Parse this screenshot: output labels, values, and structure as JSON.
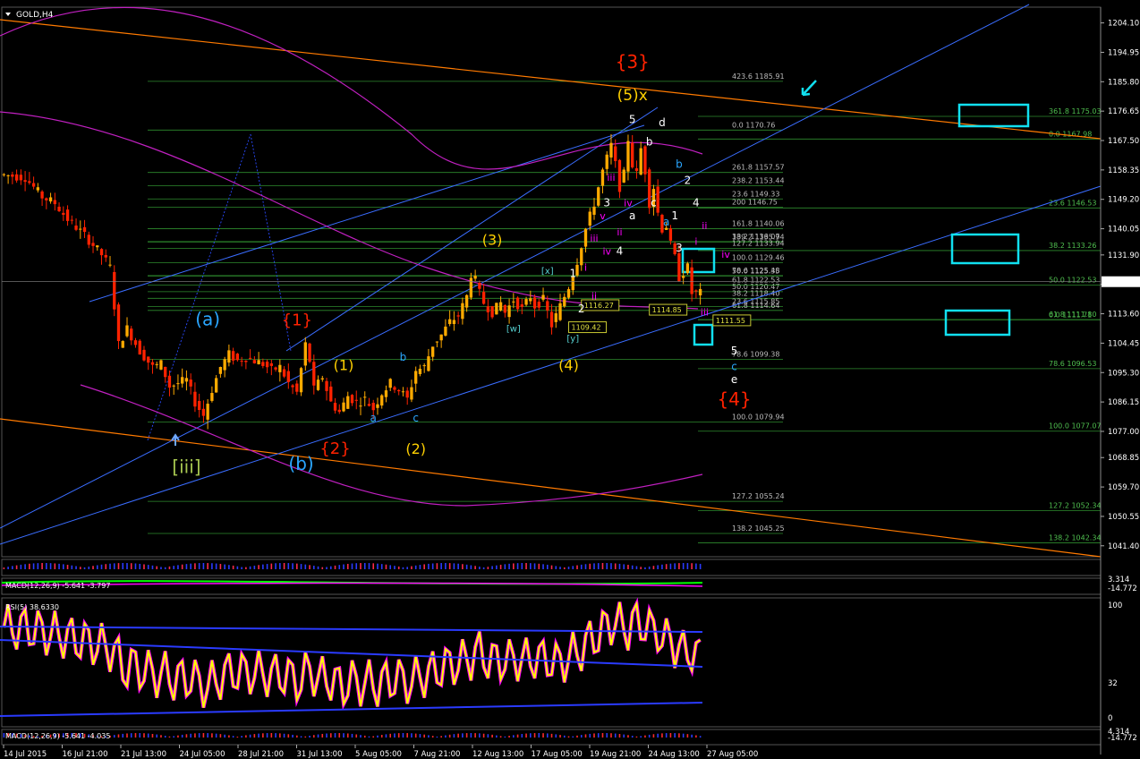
{
  "symbol": "GOLD,H4",
  "chart_data": {
    "type": "candlestick",
    "title": "GOLD,H4",
    "ylim": [
      1038.0,
      1209.0
    ],
    "ticks": [
      "1204.10",
      "1194.95",
      "1185.80",
      "1176.65",
      "1167.50",
      "1158.35",
      "1149.20",
      "1140.05",
      "1131.90",
      "1122.75",
      "1113.60",
      "1104.45",
      "1095.30",
      "1086.15",
      "1077.00",
      "1068.85",
      "1059.70",
      "1050.55",
      "1041.40"
    ],
    "current_price": "1123.58",
    "time_labels": [
      "14 Jul 2015",
      "16 Jul 21:00",
      "21 Jul 13:00",
      "24 Jul 05:00",
      "28 Jul 21:00",
      "31 Jul 13:00",
      "5 Aug 05:00",
      "7 Aug 21:00",
      "12 Aug 13:00",
      "17 Aug 05:00",
      "19 Aug 21:00",
      "24 Aug 13:00",
      "27 Aug 05:00"
    ],
    "price_path": [
      [
        0,
        1157
      ],
      [
        6,
        1156
      ],
      [
        10,
        1150
      ],
      [
        13,
        1148
      ],
      [
        16,
        1143
      ],
      [
        20,
        1138
      ],
      [
        24,
        1132
      ],
      [
        26,
        1128
      ],
      [
        28,
        1104
      ],
      [
        30,
        1109
      ],
      [
        33,
        1102
      ],
      [
        36,
        1097
      ],
      [
        38,
        1098
      ],
      [
        40,
        1091
      ],
      [
        44,
        1093
      ],
      [
        46,
        1086
      ],
      [
        48,
        1082
      ],
      [
        50,
        1090
      ],
      [
        52,
        1097
      ],
      [
        54,
        1101
      ],
      [
        56,
        1099
      ],
      [
        58,
        1100
      ],
      [
        62,
        1098
      ],
      [
        64,
        1096
      ],
      [
        66,
        1097
      ],
      [
        68,
        1092
      ],
      [
        70,
        1089
      ],
      [
        72,
        1104
      ],
      [
        73,
        1099
      ],
      [
        74,
        1090
      ],
      [
        76,
        1094
      ],
      [
        78,
        1086
      ],
      [
        80,
        1083
      ],
      [
        82,
        1088
      ],
      [
        84,
        1086
      ],
      [
        86,
        1087
      ],
      [
        88,
        1084
      ],
      [
        90,
        1089
      ],
      [
        92,
        1092
      ],
      [
        94,
        1090
      ],
      [
        96,
        1087
      ],
      [
        98,
        1096
      ],
      [
        100,
        1097
      ],
      [
        102,
        1104
      ],
      [
        104,
        1107
      ],
      [
        106,
        1111
      ],
      [
        108,
        1113
      ],
      [
        110,
        1119
      ],
      [
        111,
        1126
      ],
      [
        112,
        1124
      ],
      [
        113,
        1120
      ],
      [
        114,
        1117
      ],
      [
        116,
        1114
      ],
      [
        118,
        1117
      ],
      [
        119,
        1114
      ],
      [
        121,
        1118
      ],
      [
        123,
        1115
      ],
      [
        125,
        1119
      ],
      [
        126,
        1116
      ],
      [
        128,
        1118
      ],
      [
        130,
        1110
      ],
      [
        132,
        1116
      ],
      [
        134,
        1122
      ],
      [
        136,
        1130
      ],
      [
        138,
        1140
      ],
      [
        140,
        1148
      ],
      [
        142,
        1158
      ],
      [
        144,
        1166
      ],
      [
        145,
        1160
      ],
      [
        146,
        1153
      ],
      [
        147,
        1157
      ],
      [
        148,
        1168
      ],
      [
        149,
        1160
      ],
      [
        150,
        1157
      ],
      [
        151,
        1165
      ],
      [
        152,
        1158
      ],
      [
        153,
        1148
      ],
      [
        154,
        1153
      ],
      [
        155,
        1145
      ],
      [
        156,
        1140
      ],
      [
        157,
        1141
      ],
      [
        158,
        1135
      ],
      [
        159,
        1131
      ],
      [
        160,
        1125
      ],
      [
        162,
        1128
      ],
      [
        163,
        1120
      ],
      [
        164,
        1120
      ]
    ],
    "candles_count": 165,
    "elliott_labels": [
      {
        "t": "{3}",
        "x": 148,
        "y": 1190,
        "color": "#ff2200",
        "size": 20
      },
      {
        "t": "(5)x",
        "x": 148,
        "y": 1180,
        "color": "#ffd000",
        "size": 17
      },
      {
        "t": "5",
        "x": 148,
        "y": 1173,
        "color": "#ffffff",
        "size": 12
      },
      {
        "t": "d",
        "x": 155,
        "y": 1172,
        "color": "#ffffff",
        "size": 12
      },
      {
        "t": "b",
        "x": 152,
        "y": 1166,
        "color": "#ffffff",
        "size": 12
      },
      {
        "t": "b",
        "x": 159,
        "y": 1159,
        "color": "#2aa6ff",
        "size": 12
      },
      {
        "t": "2",
        "x": 161,
        "y": 1154,
        "color": "#ffffff",
        "size": 12
      },
      {
        "t": "iii",
        "x": 143,
        "y": 1155,
        "color": "#ff00ff",
        "size": 11
      },
      {
        "t": "3",
        "x": 142,
        "y": 1147,
        "color": "#ffffff",
        "size": 12
      },
      {
        "t": "v",
        "x": 141,
        "y": 1143,
        "color": "#ff00ff",
        "size": 11
      },
      {
        "t": "iv",
        "x": 147,
        "y": 1147,
        "color": "#ff00ff",
        "size": 11
      },
      {
        "t": "a",
        "x": 148,
        "y": 1143,
        "color": "#ffffff",
        "size": 12
      },
      {
        "t": "c",
        "x": 153,
        "y": 1147,
        "color": "#ffffff",
        "size": 12
      },
      {
        "t": "1",
        "x": 158,
        "y": 1143,
        "color": "#ffffff",
        "size": 12
      },
      {
        "t": "a",
        "x": 156,
        "y": 1141,
        "color": "#2aa6ff",
        "size": 12
      },
      {
        "t": "4",
        "x": 163,
        "y": 1147,
        "color": "#ffffff",
        "size": 12
      },
      {
        "t": "ii",
        "x": 165,
        "y": 1140,
        "color": "#ff00ff",
        "size": 11
      },
      {
        "t": "i",
        "x": 163,
        "y": 1135,
        "color": "#ff00ff",
        "size": 11
      },
      {
        "t": "3",
        "x": 159,
        "y": 1133,
        "color": "#ffffff",
        "size": 12
      },
      {
        "t": "iii",
        "x": 139,
        "y": 1136,
        "color": "#ff00ff",
        "size": 11
      },
      {
        "t": "ii",
        "x": 145,
        "y": 1138,
        "color": "#ff00ff",
        "size": 11
      },
      {
        "t": "iv",
        "x": 142,
        "y": 1132,
        "color": "#ff00ff",
        "size": 11
      },
      {
        "t": "4",
        "x": 145,
        "y": 1132,
        "color": "#ffffff",
        "size": 12
      },
      {
        "t": "i",
        "x": 137,
        "y": 1127,
        "color": "#ff00ff",
        "size": 11
      },
      {
        "t": "1",
        "x": 134,
        "y": 1125,
        "color": "#ffffff",
        "size": 12
      },
      {
        "t": "ii",
        "x": 139,
        "y": 1118,
        "color": "#ff00ff",
        "size": 11
      },
      {
        "t": "2",
        "x": 136,
        "y": 1114,
        "color": "#ffffff",
        "size": 12
      },
      {
        "t": "(3)",
        "x": 115,
        "y": 1135,
        "color": "#ffd000",
        "size": 16
      },
      {
        "t": "[x]",
        "x": 128,
        "y": 1126,
        "color": "#56d0d0",
        "size": 10
      },
      {
        "t": "[w]",
        "x": 120,
        "y": 1108,
        "color": "#56d0d0",
        "size": 10
      },
      {
        "t": "[y]",
        "x": 134,
        "y": 1105,
        "color": "#56d0d0",
        "size": 10
      },
      {
        "t": "(4)",
        "x": 133,
        "y": 1096,
        "color": "#ffd000",
        "size": 16
      },
      {
        "t": "iii",
        "x": 165,
        "y": 1113,
        "color": "#ff00ff",
        "size": 11
      },
      {
        "t": "iv",
        "x": 170,
        "y": 1131,
        "color": "#ff00ff",
        "size": 11
      },
      {
        "t": "5",
        "x": 172,
        "y": 1101,
        "color": "#ffffff",
        "size": 12
      },
      {
        "t": "c",
        "x": 172,
        "y": 1096,
        "color": "#2aa6ff",
        "size": 12
      },
      {
        "t": "e",
        "x": 172,
        "y": 1092,
        "color": "#ffffff",
        "size": 12
      },
      {
        "t": "{4}",
        "x": 172,
        "y": 1085,
        "color": "#ff2200",
        "size": 20
      },
      {
        "t": "(a)",
        "x": 48,
        "y": 1110,
        "color": "#2aa6ff",
        "size": 20
      },
      {
        "t": "{1}",
        "x": 69,
        "y": 1110,
        "color": "#ff2200",
        "size": 18
      },
      {
        "t": "(1)",
        "x": 80,
        "y": 1096,
        "color": "#ffd000",
        "size": 16
      },
      {
        "t": "b",
        "x": 94,
        "y": 1099,
        "color": "#2aa6ff",
        "size": 12
      },
      {
        "t": "a",
        "x": 87,
        "y": 1080,
        "color": "#2aa6ff",
        "size": 12
      },
      {
        "t": "c",
        "x": 97,
        "y": 1080,
        "color": "#2aa6ff",
        "size": 12
      },
      {
        "t": "(2)",
        "x": 97,
        "y": 1070,
        "color": "#ffd000",
        "size": 16
      },
      {
        "t": "{2}",
        "x": 78,
        "y": 1070,
        "color": "#ff2200",
        "size": 18
      },
      {
        "t": "(b)",
        "x": 70,
        "y": 1065,
        "color": "#2aa6ff",
        "size": 20
      },
      {
        "t": "[iii]",
        "x": 43,
        "y": 1064,
        "color": "#a8c850",
        "size": 20
      }
    ],
    "fib_left": [
      {
        "label": "423.6  1185.91",
        "price": 1185.91
      },
      {
        "label": "0.0  1170.76",
        "price": 1170.76
      },
      {
        "label": "261.8  1157.57",
        "price": 1157.57
      },
      {
        "label": "238.2  1153.44",
        "price": 1153.44
      },
      {
        "label": "23.6  1149.33",
        "price": 1149.33
      },
      {
        "label": "200  1146.75",
        "price": 1146.75
      },
      {
        "label": "161.8  1140.06",
        "price": 1140.06
      },
      {
        "label": "38.2  1136.07",
        "price": 1136.07
      },
      {
        "label": "139.2  1135.94",
        "price": 1135.94
      },
      {
        "label": "127.2  1133.94",
        "price": 1133.94
      },
      {
        "label": "100.0  1129.46",
        "price": 1129.46
      },
      {
        "label": "50.0  1125.35",
        "price": 1125.35
      },
      {
        "label": "78.6  1125.48",
        "price": 1125.48
      },
      {
        "label": "61.8  1122.53",
        "price": 1122.53
      },
      {
        "label": "50.0  1120.47",
        "price": 1120.47
      },
      {
        "label": "38.2  1118.40",
        "price": 1118.4
      },
      {
        "label": "23.6  1115.85",
        "price": 1115.85
      },
      {
        "label": "61.8  1114.64",
        "price": 1114.64
      },
      {
        "label": "78.6  1099.38",
        "price": 1099.38
      },
      {
        "label": "100.0  1079.94",
        "price": 1079.94
      },
      {
        "label": "127.2  1055.24",
        "price": 1055.24
      },
      {
        "label": "138.2  1045.25",
        "price": 1045.25
      }
    ],
    "fib_right": [
      {
        "label": "361.8  1175.03",
        "price": 1175.03
      },
      {
        "label": "0.0  1167.98",
        "price": 1167.98
      },
      {
        "label": "23.6  1146.53",
        "price": 1146.53
      },
      {
        "label": "38.2  1133.26",
        "price": 1133.26
      },
      {
        "label": "50.0  1122.53",
        "price": 1122.53
      },
      {
        "label": "0.0  1111.71",
        "price": 1111.71
      },
      {
        "label": "61.8  1111.80",
        "price": 1111.8
      },
      {
        "label": "78.6  1096.53",
        "price": 1096.53
      },
      {
        "label": "100.0  1077.07",
        "price": 1077.07
      },
      {
        "label": "127.2  1052.34",
        "price": 1052.34
      },
      {
        "label": "138.2  1042.34",
        "price": 1042.34
      }
    ],
    "price_tags": [
      {
        "label": "1116.27",
        "x": 136,
        "price": 1116.27
      },
      {
        "label": "1114.85",
        "x": 152,
        "price": 1114.85
      },
      {
        "label": "1109.42",
        "x": 133,
        "price": 1109.42
      },
      {
        "label": "1111.55",
        "x": 167,
        "price": 1111.55
      }
    ],
    "sub_panels": [
      {
        "label": "MACD(12,26,9) -5.641 -3.797",
        "scale_top": "3.314",
        "scale_bottom": "-14.772"
      },
      {
        "label": "RSI(5) 38.6330",
        "scale_top": "100",
        "scale_mid": "32",
        "scale_bottom": "0"
      },
      {
        "label": "MACD(12,26,9) -5.641 -4.035",
        "scale_top": "4.314",
        "scale_bottom": "-14.772"
      }
    ],
    "colors": {
      "bull": "#ffaa00",
      "bear": "#ff2200",
      "grid": "#202020",
      "fib": "#2e8b2e",
      "trend": "#3a6dff",
      "ma": "#c020c0",
      "channel": "#ff7a00",
      "box": "#11e0f0"
    }
  }
}
